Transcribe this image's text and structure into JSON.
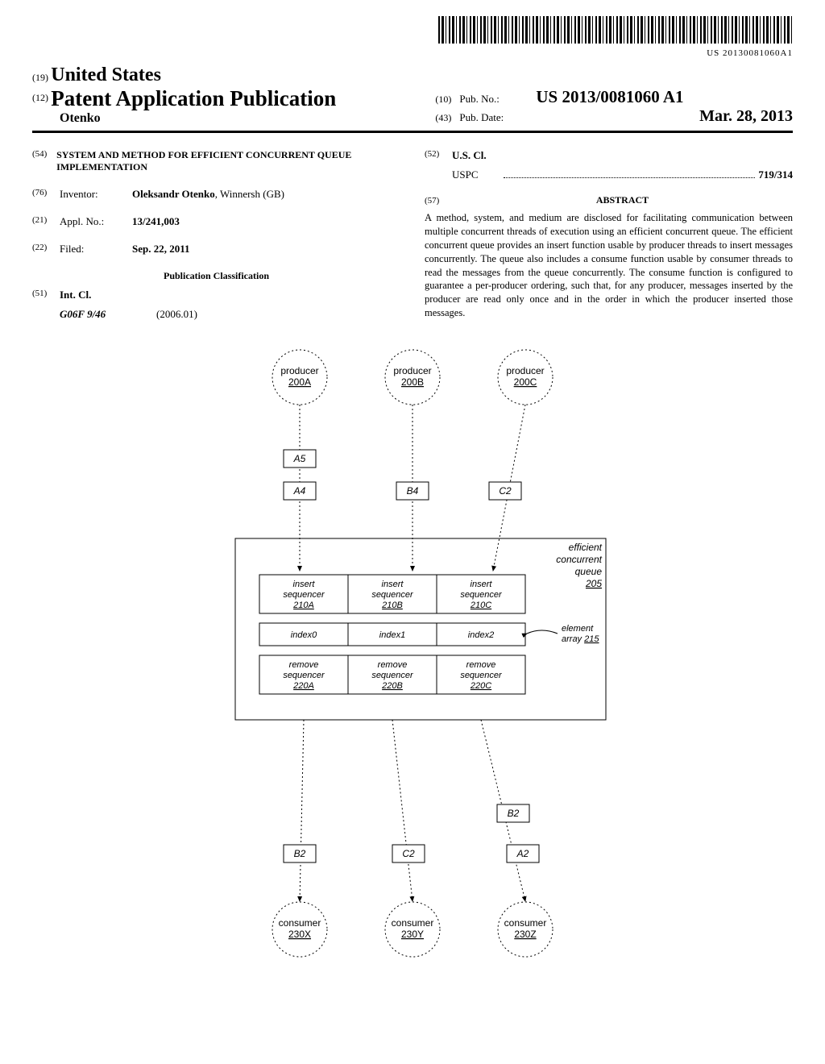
{
  "barcode_text": "US 20130081060A1",
  "header": {
    "num19": "(19)",
    "country": "United States",
    "num12": "(12)",
    "pub_title": "Patent Application Publication",
    "inventor_last": "Otenko",
    "num10": "(10)",
    "pubno_label": "Pub. No.:",
    "pubno_value": "US 2013/0081060 A1",
    "num43": "(43)",
    "pubdate_label": "Pub. Date:",
    "pubdate_value": "Mar. 28, 2013"
  },
  "left": {
    "num54": "(54)",
    "title": "SYSTEM AND METHOD FOR EFFICIENT CONCURRENT QUEUE IMPLEMENTATION",
    "num76": "(76)",
    "inventor_label": "Inventor:",
    "inventor_value": "Oleksandr Otenko",
    "inventor_loc": ", Winnersh (GB)",
    "num21": "(21)",
    "appl_label": "Appl. No.:",
    "appl_value": "13/241,003",
    "num22": "(22)",
    "filed_label": "Filed:",
    "filed_value": "Sep. 22, 2011",
    "pubclass_head": "Publication Classification",
    "num51": "(51)",
    "intcl_label": "Int. Cl.",
    "intcl_code": "G06F 9/46",
    "intcl_date": "(2006.01)"
  },
  "right": {
    "num52": "(52)",
    "uscl_label": "U.S. Cl.",
    "uspc_label": "USPC",
    "uspc_value": "719/314",
    "num57": "(57)",
    "abstract_head": "ABSTRACT",
    "abstract_body": "A method, system, and medium are disclosed for facilitating communication between multiple concurrent threads of execution using an efficient concurrent queue. The efficient concurrent queue provides an insert function usable by producer threads to insert messages concurrently. The queue also includes a consume function usable by consumer threads to read the messages from the queue concurrently. The consume function is configured to guarantee a per-producer ordering, such that, for any producer, messages inserted by the producer are read only once and in the order in which the producer inserted those messages."
  },
  "figure": {
    "producers": [
      {
        "label": "producer",
        "id": "200A"
      },
      {
        "label": "producer",
        "id": "200B"
      },
      {
        "label": "producer",
        "id": "200C"
      }
    ],
    "top_msgs": {
      "a5": "A5",
      "a4": "A4",
      "b4": "B4",
      "c2": "C2"
    },
    "queue_label": "efficient\nconcurrent\nqueue",
    "queue_id": "205",
    "insert_seq": [
      {
        "l1": "insert",
        "l2": "sequencer",
        "id": "210A"
      },
      {
        "l1": "insert",
        "l2": "sequencer",
        "id": "210B"
      },
      {
        "l1": "insert",
        "l2": "sequencer",
        "id": "210C"
      }
    ],
    "index_row": [
      "index0",
      "index1",
      "index2"
    ],
    "element_array_label": "element\narray",
    "element_array_id": "215",
    "remove_seq": [
      {
        "l1": "remove",
        "l2": "sequencer",
        "id": "220A"
      },
      {
        "l1": "remove",
        "l2": "sequencer",
        "id": "220B"
      },
      {
        "l1": "remove",
        "l2": "sequencer",
        "id": "220C"
      }
    ],
    "bottom_msgs": {
      "b2a": "B2",
      "c2": "C2",
      "b2b": "B2",
      "a2": "A2"
    },
    "consumers": [
      {
        "label": "consumer",
        "id": "230X"
      },
      {
        "label": "consumer",
        "id": "230Y"
      },
      {
        "label": "consumer",
        "id": "230Z"
      }
    ]
  }
}
